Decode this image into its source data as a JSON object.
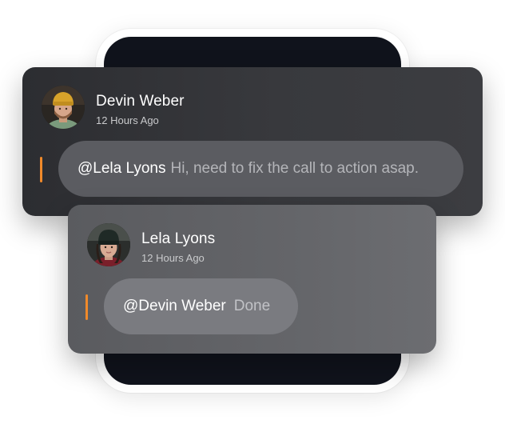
{
  "comments": [
    {
      "author": "Devin Weber",
      "time": "12 Hours Ago",
      "mention": "@Lela Lyons",
      "message": "Hi, need to fix the call to action asap.",
      "avatar_icon": "person-with-yellow-beanie-avatar"
    },
    {
      "author": "Lela Lyons",
      "time": "12 Hours Ago",
      "mention": "@Devin Weber",
      "message": "Done",
      "avatar_icon": "person-with-dark-beanie-avatar"
    }
  ],
  "colors": {
    "accent": "#f08a2a",
    "phone_screen": "#10131c",
    "card_1": "#333438",
    "card_2": "#636468"
  }
}
